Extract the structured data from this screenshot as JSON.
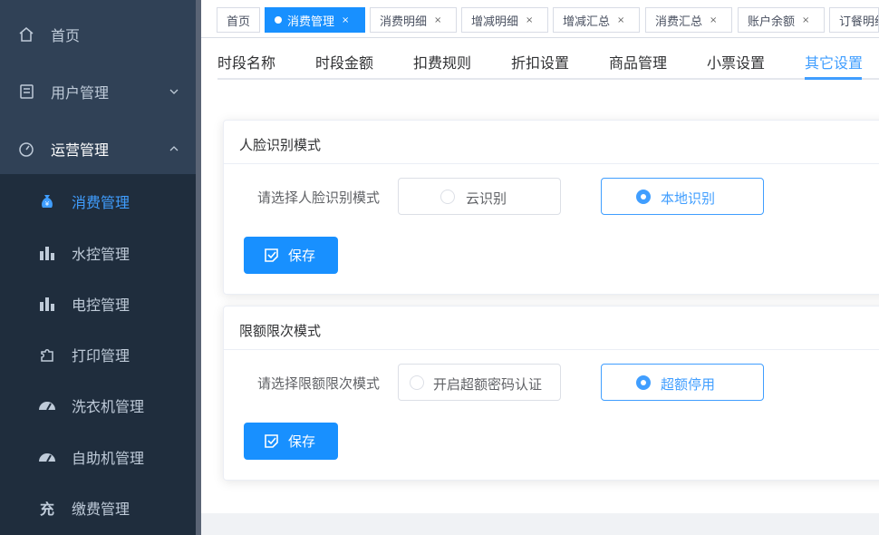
{
  "sidebar": {
    "menu": [
      {
        "label": "首页",
        "icon": "home-icon"
      },
      {
        "label": "用户管理",
        "icon": "users-icon",
        "arrow": "chevron-down-icon"
      },
      {
        "label": "运营管理",
        "icon": "dashboard-icon",
        "arrow": "chevron-up-icon"
      }
    ],
    "submenu": [
      {
        "label": "消费管理",
        "icon": "money-bag-icon",
        "active": true
      },
      {
        "label": "水控管理",
        "icon": "bar-chart-icon"
      },
      {
        "label": "电控管理",
        "icon": "bar-chart-icon"
      },
      {
        "label": "打印管理",
        "icon": "puzzle-icon"
      },
      {
        "label": "洗衣机管理",
        "icon": "gauge-icon"
      },
      {
        "label": "自助机管理",
        "icon": "gauge-icon"
      },
      {
        "label": "缴费管理",
        "icon_text": "充"
      }
    ]
  },
  "tags": [
    {
      "label": "首页",
      "closable": false
    },
    {
      "label": "消费管理",
      "active": true,
      "close": "×"
    },
    {
      "label": "消费明细",
      "close": "×"
    },
    {
      "label": "增减明细",
      "close": "×"
    },
    {
      "label": "增减汇总",
      "close": "×"
    },
    {
      "label": "消费汇总",
      "close": "×"
    },
    {
      "label": "账户余额",
      "close": "×"
    },
    {
      "label": "订餐明细"
    }
  ],
  "sub_tabs": [
    "时段名称",
    "时段金额",
    "扣费规则",
    "折扣设置",
    "商品管理",
    "小票设置",
    "其它设置"
  ],
  "active_sub_tab": "其它设置",
  "face_card": {
    "title": "人脸识别模式",
    "label": "请选择人脸识别模式",
    "options": [
      {
        "label": "云识别",
        "checked": false
      },
      {
        "label": "本地识别",
        "checked": true
      }
    ],
    "save_label": "保存"
  },
  "limit_card": {
    "title": "限额限次模式",
    "label": "请选择限额限次模式",
    "options": [
      {
        "label": "开启超额密码认证",
        "checked": false
      },
      {
        "label": "超额停用",
        "checked": true
      }
    ],
    "save_label": "保存"
  },
  "colors": {
    "primary": "#1890ff",
    "sidebar": "#304156",
    "sidebar_sub": "#1f2d3d",
    "active_text": "#409eff"
  }
}
